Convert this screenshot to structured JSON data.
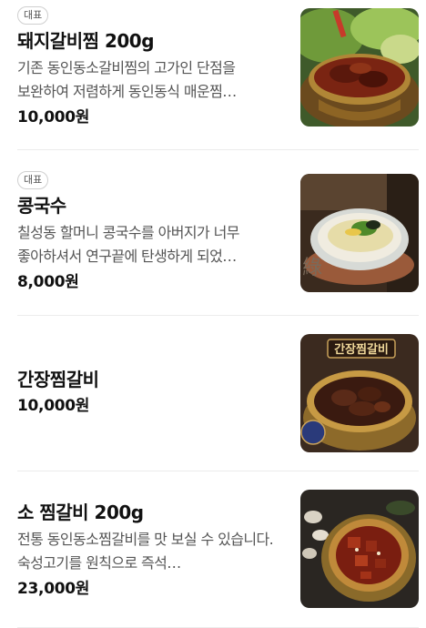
{
  "menu_items": [
    {
      "badge": "대표",
      "name": "돼지갈비찜 200g",
      "description": "기존 동인동소갈비찜의 고가인 단점을 보완하여 저렴하게 동인동식 매운찜…",
      "price": "10,000원",
      "image_icon": "braised-pork-ribs-photo"
    },
    {
      "badge": "대표",
      "name": "콩국수",
      "description": "칠성동 할머니 콩국수를 아버지가 너무 좋아하셔서 연구끝에 탄생하게 되었…",
      "price": "8,000원",
      "image_icon": "soy-milk-noodle-photo"
    },
    {
      "name": "간장찜갈비",
      "price": "10,000원",
      "image_text": "간장찜갈비",
      "image_icon": "soy-braised-ribs-photo"
    },
    {
      "name": "소 찜갈비 200g",
      "description": "전통 동인동소찜갈비를 맛 보실 수 있습니다. 숙성고기를 원칙으로 즉석…",
      "price": "23,000원",
      "image_icon": "braised-beef-ribs-photo"
    }
  ]
}
